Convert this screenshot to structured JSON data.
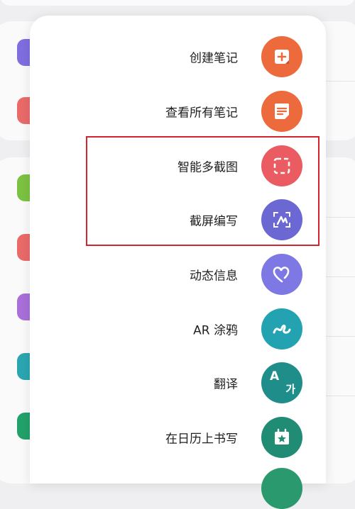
{
  "menu": {
    "items": [
      {
        "label": "创建笔记",
        "icon": "add-note-icon",
        "color": "#ec6a3c"
      },
      {
        "label": "查看所有笔记",
        "icon": "note-list-icon",
        "color": "#ec6a3c"
      },
      {
        "label": "智能多截图",
        "icon": "smart-select-icon",
        "color": "#ea5c62"
      },
      {
        "label": "截屏编写",
        "icon": "screen-write-icon",
        "color": "#6b67d3"
      },
      {
        "label": "动态信息",
        "icon": "live-message-icon",
        "color": "#7d78e3"
      },
      {
        "label": "AR 涂鸦",
        "icon": "ar-doodle-icon",
        "color": "#23a3b2"
      },
      {
        "label": "翻译",
        "icon": "translate-icon",
        "color": "#1f8e8a"
      },
      {
        "label": "在日历上书写",
        "icon": "write-on-calendar-icon",
        "color": "#1f8c73"
      }
    ],
    "translate_glyph_a": "A",
    "translate_glyph_b": "가"
  },
  "background_icon_colors": [
    "#7e6ee0",
    "#ea6a6a",
    "#7cc242",
    "#ea6a6a",
    "#a870d8",
    "#2aa6b0",
    "#22a16a"
  ],
  "highlight_color": "#d4252f"
}
